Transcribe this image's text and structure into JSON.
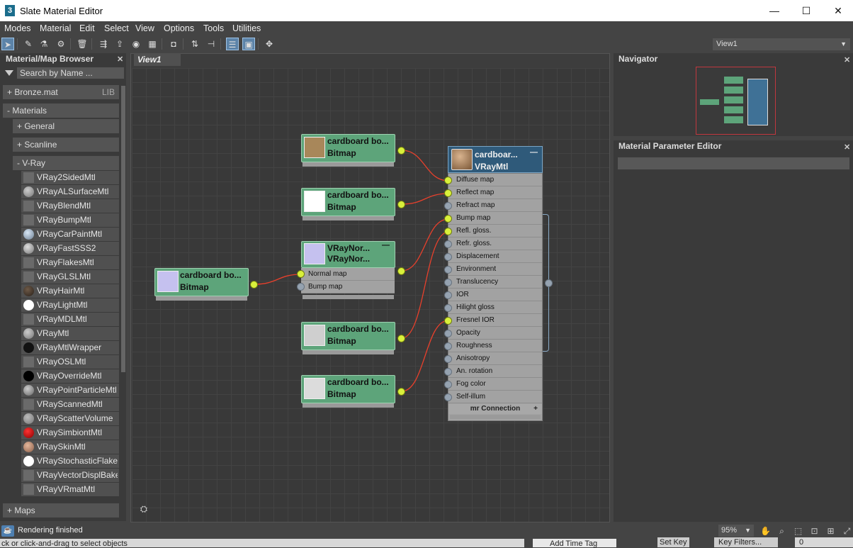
{
  "window": {
    "title": "Slate Material Editor",
    "icon": "3",
    "minimize": "—",
    "maximize": "☐",
    "close": "✕"
  },
  "menu": [
    "Modes",
    "Material",
    "Edit",
    "Select",
    "View",
    "Options",
    "Tools",
    "Utilities"
  ],
  "toolbar": {
    "view_select": "View1"
  },
  "browser": {
    "title": "Material/Map Browser",
    "search_placeholder": "Search by Name ...",
    "library": {
      "label": "+ Bronze.mat",
      "annotation": "LIB"
    },
    "materials_group": "- Materials",
    "general": "+ General",
    "scanline": "+ Scanline",
    "vray": "- V-Ray",
    "items": [
      "VRay2SidedMtl",
      "VRayALSurfaceMtl",
      "VRayBlendMtl",
      "VRayBumpMtl",
      "VRayCarPaintMtl",
      "VRayFastSSS2",
      "VRayFlakesMtl",
      "VRayGLSLMtl",
      "VRayHairMtl",
      "VRayLightMtl",
      "VRayMDLMtl",
      "VRayMtl",
      "VRayMtlWrapper",
      "VRayOSLMtl",
      "VRayOverrideMtl",
      "VRayPointParticleMtl",
      "VRayScannedMtl",
      "VRayScatterVolume",
      "VRaySimbiontMtl",
      "VRaySkinMtl",
      "VRayStochasticFlake...",
      "VRayVectorDisplBake",
      "VRayVRmatMtl"
    ],
    "maps_group": "+ Maps"
  },
  "view": {
    "tab": "View1"
  },
  "nodes": {
    "bitmap1": {
      "title": "cardboard bo...",
      "subtitle": "Bitmap"
    },
    "bitmap2": {
      "title": "cardboard bo...",
      "subtitle": "Bitmap"
    },
    "normal": {
      "title": "VRayNor...",
      "subtitle": "VRayNor...",
      "slot_normal": "Normal map",
      "slot_bump": "Bump map"
    },
    "bitmap3": {
      "title": "cardboard bo...",
      "subtitle": "Bitmap"
    },
    "bitmap4": {
      "title": "cardboard bo...",
      "subtitle": "Bitmap"
    },
    "bitmap5": {
      "title": "cardboard bo...",
      "subtitle": "Bitmap"
    },
    "vray": {
      "title": "cardboar...",
      "subtitle": "VRayMtl",
      "collapse": "—",
      "footer": "mr Connection",
      "footer_icon": "+",
      "slots": [
        "Diffuse map",
        "Reflect map",
        "Refract map",
        "Bump map",
        "Refl. gloss.",
        "Refr. gloss.",
        "Displacement",
        "Environment",
        "Translucency",
        "IOR",
        "Hilight gloss",
        "Fresnel IOR",
        "Opacity",
        "Roughness",
        "Anisotropy",
        "An. rotation",
        "Fog color",
        "Self-illum"
      ]
    }
  },
  "navigator": {
    "title": "Navigator"
  },
  "parameter_editor": {
    "title": "Material Parameter Editor"
  },
  "status": {
    "text": "Rendering finished",
    "prompt": "ck or click-and-drag to select objects",
    "zoom": "95%",
    "time_tag": "Add Time Tag",
    "set_key": "Set Key",
    "key_filters": "Key Filters...",
    "frame": "0"
  },
  "colors": {
    "node_green": "#5da47a",
    "vray_header": "#2f5a7a",
    "socket_connected": "#d9f03b",
    "wire": "#e8402c"
  }
}
